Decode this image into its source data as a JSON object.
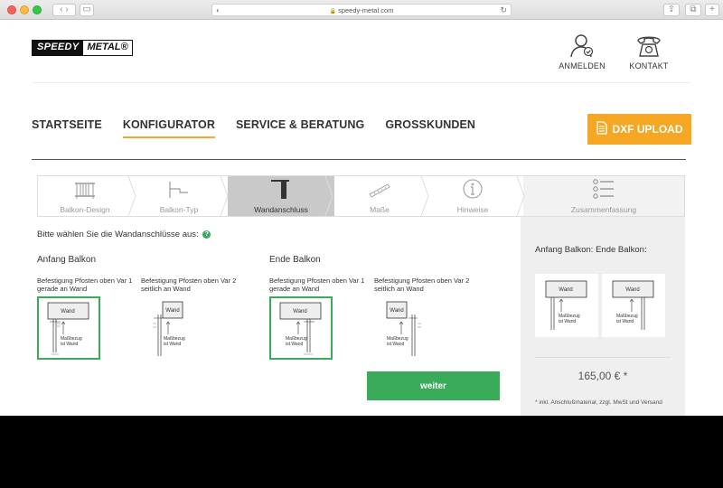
{
  "browser": {
    "url": "speedy-metal.com"
  },
  "header": {
    "logo_part1": "SPEEDY",
    "logo_part2": "METAL®",
    "login_label": "ANMELDEN",
    "contact_label": "KONTAKT"
  },
  "nav": {
    "items": [
      "STARTSEITE",
      "KONFIGURATOR",
      "SERVICE & BERATUNG",
      "GROSSKUNDEN"
    ],
    "active_index": 1,
    "dxf_label": "DXF UPLOAD"
  },
  "steps": [
    {
      "label": "Balkon-Design",
      "icon": "railing-icon"
    },
    {
      "label": "Balkon-Typ",
      "icon": "balcony-type-icon"
    },
    {
      "label": "Wandanschluss",
      "icon": "wall-mount-icon"
    },
    {
      "label": "Maße",
      "icon": "ruler-icon"
    },
    {
      "label": "Hinweise",
      "icon": "info-icon"
    },
    {
      "label": "Zusammenfassung",
      "icon": "list-icon"
    }
  ],
  "active_step": 2,
  "content": {
    "prompt": "Bitte wählen Sie die Wandanschlüsse aus:",
    "help_glyph": "?",
    "start": {
      "title": "Anfang Balkon",
      "options": [
        {
          "label": "Befestigung Pfosten oben Var 1 gerade an Wand",
          "selected": true
        },
        {
          "label": "Befestigung Pfosten oben Var 2 seitlich an Wand",
          "selected": false
        }
      ]
    },
    "end": {
      "title": "Ende Balkon",
      "options": [
        {
          "label": "Befestigung Pfosten oben Var 1 gerade an Wand",
          "selected": true
        },
        {
          "label": "Befestigung Pfosten oben Var 2 seitlich an Wand",
          "selected": false
        }
      ]
    },
    "diagram": {
      "wall_label": "Wand",
      "note_line1": "Maßbezug",
      "note_line2": "ist Wand"
    },
    "next_button": "weiter"
  },
  "sidebar": {
    "title": "Anfang Balkon: Ende Balkon:",
    "price": "165,00 € *",
    "note": "* inkl. Anschlußmaterial, zzgl. MwSt und Versand"
  },
  "colors": {
    "accent_orange": "#f5a623",
    "accent_green": "#3aaa5b"
  }
}
